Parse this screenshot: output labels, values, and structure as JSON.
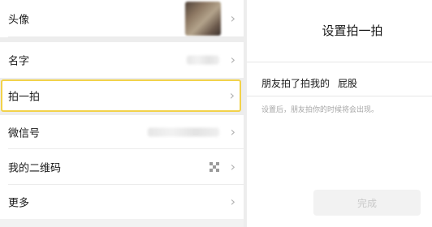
{
  "profile": {
    "rows": [
      {
        "key": "avatar",
        "label": "头像"
      },
      {
        "key": "name",
        "label": "名字"
      },
      {
        "key": "pat",
        "label": "拍一拍"
      },
      {
        "key": "wechat_id",
        "label": "微信号"
      },
      {
        "key": "qr_code",
        "label": "我的二维码"
      },
      {
        "key": "more",
        "label": "更多"
      }
    ],
    "chevron": "›",
    "icons": {
      "chevron": "chevron-right-icon",
      "qr": "qr-code-icon"
    },
    "highlight_color": "#f2d24a"
  },
  "pat_settings": {
    "title": "设置拍一拍",
    "prefix": "朋友拍了拍我的",
    "suffix": "屁股",
    "hint": "设置后，朋友拍你的时候将会出现。",
    "done_label": "完成",
    "accent_color": "#07c160"
  }
}
